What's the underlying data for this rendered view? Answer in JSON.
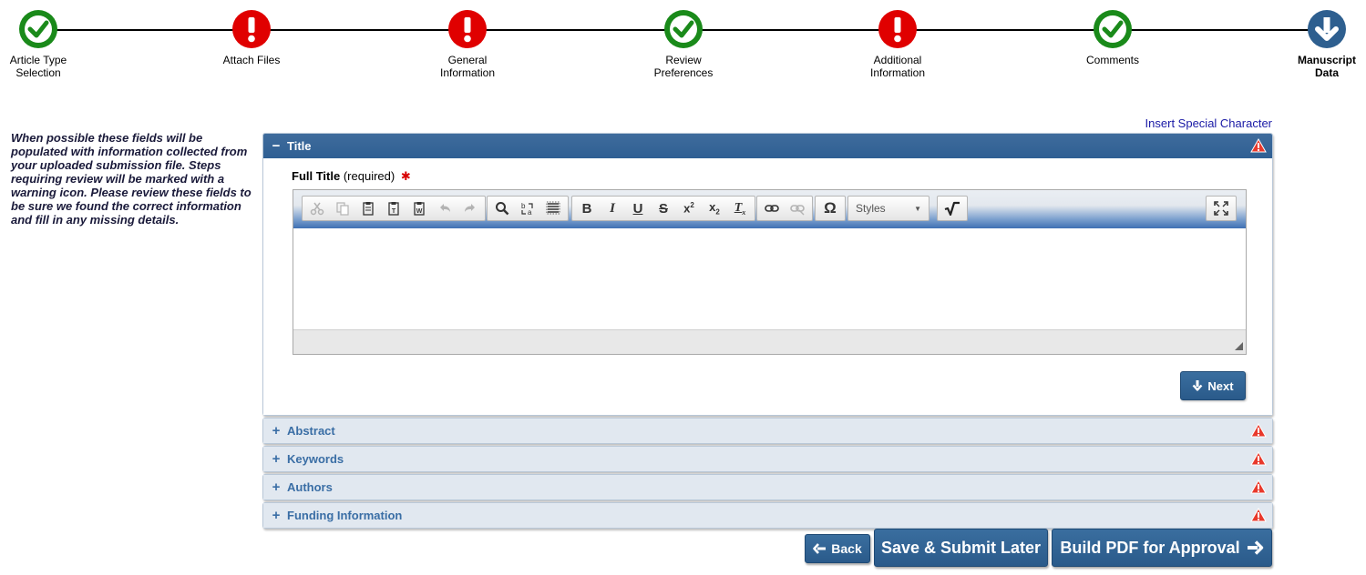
{
  "progress": {
    "steps": [
      {
        "label": "Article Type\nSelection",
        "status": "complete",
        "icon": "check-circle-icon"
      },
      {
        "label": "Attach Files",
        "status": "warning",
        "icon": "exclamation-circle-icon"
      },
      {
        "label": "General\nInformation",
        "status": "warning",
        "icon": "exclamation-circle-icon"
      },
      {
        "label": "Review\nPreferences",
        "status": "complete",
        "icon": "check-circle-icon"
      },
      {
        "label": "Additional\nInformation",
        "status": "warning",
        "icon": "exclamation-circle-icon"
      },
      {
        "label": "Comments",
        "status": "complete",
        "icon": "check-circle-icon"
      },
      {
        "label": "Manuscript\nData",
        "status": "current",
        "icon": "arrow-down-circle-icon"
      }
    ],
    "colors": {
      "complete": "#1a8a1a",
      "warning": "#e00000",
      "current": "#2e5f8f"
    }
  },
  "help_text": "When possible these fields will be populated with information collected from your uploaded submission file. Steps requiring review will be marked with a warning icon. Please review these fields to be sure we found the correct information and fill in any missing details.",
  "insert_special_character": "Insert Special Character",
  "sections": {
    "title": {
      "label": "Title",
      "field_label": "Full Title",
      "field_hint": "(required)",
      "required_mark": "✱",
      "editor": {
        "styles_label": "Styles"
      },
      "next_label": "Next"
    },
    "collapsed": [
      {
        "label": "Abstract"
      },
      {
        "label": "Keywords"
      },
      {
        "label": "Authors"
      },
      {
        "label": "Funding Information"
      }
    ]
  },
  "footer": {
    "back_label": "Back",
    "save_label": "Save & Submit Later",
    "pdf_label": "Build PDF for Approval"
  }
}
